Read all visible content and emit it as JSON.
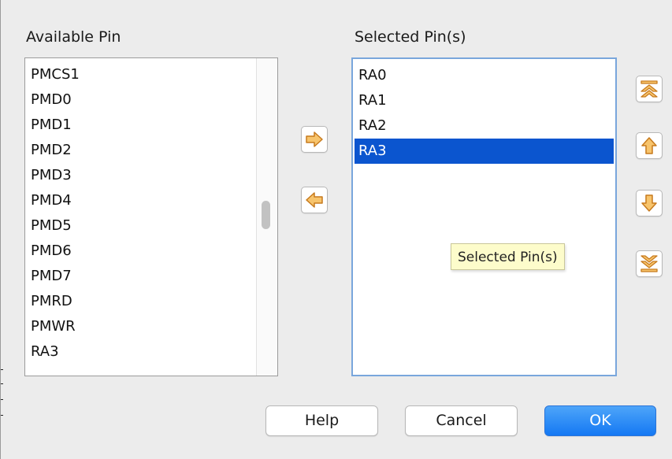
{
  "available": {
    "title": "Available Pin",
    "items": [
      "PMCS1",
      "PMD0",
      "PMD1",
      "PMD2",
      "PMD3",
      "PMD4",
      "PMD5",
      "PMD6",
      "PMD7",
      "PMRD",
      "PMWR",
      "RA3"
    ]
  },
  "selected": {
    "title": "Selected Pin(s)",
    "items": [
      "RA0",
      "RA1",
      "RA2",
      "RA3"
    ],
    "selected_index": 3
  },
  "tooltip": {
    "text": "Selected Pin(s)"
  },
  "transfer_buttons": {
    "add_icon": "arrow-right-icon",
    "remove_icon": "arrow-left-icon"
  },
  "order_buttons": {
    "top_icon": "move-to-top-icon",
    "up_icon": "arrow-up-icon",
    "down_icon": "arrow-down-icon",
    "bottom_icon": "move-to-bottom-icon"
  },
  "footer": {
    "help_label": "Help",
    "cancel_label": "Cancel",
    "ok_label": "OK"
  },
  "colors": {
    "selection": "#0b55cf",
    "primary_button": "#1478f3",
    "arrow_fill": "#f7c46c",
    "arrow_stroke": "#c77a1d",
    "tooltip_background": "#fdfccb"
  }
}
